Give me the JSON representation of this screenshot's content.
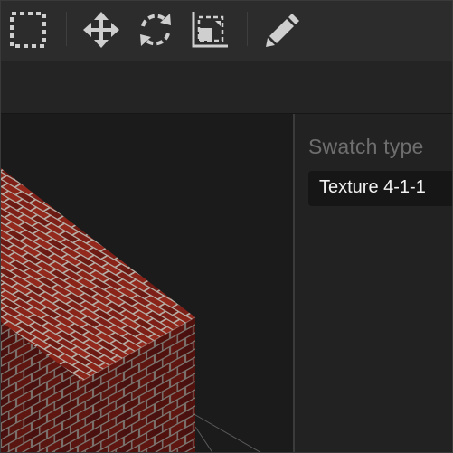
{
  "toolbar": {
    "tools": [
      {
        "name": "selection-marquee",
        "icon": "dashed-square-icon"
      },
      {
        "name": "move",
        "icon": "four-arrows-icon"
      },
      {
        "name": "rotate",
        "icon": "rotate-arrows-icon"
      },
      {
        "name": "scale",
        "icon": "scale-corner-icon"
      },
      {
        "name": "edit",
        "icon": "pencil-icon"
      }
    ],
    "icon_color": "#cfcfcf"
  },
  "inspector": {
    "swatch_type_label": "Swatch type",
    "swatch_type_value": "Texture 4-1-1"
  },
  "viewport": {
    "object": "brick-textured-cube",
    "colors": {
      "brick": "#7a1e16",
      "mortar": "#b9b0a8",
      "background": "#1b1b1b"
    }
  }
}
